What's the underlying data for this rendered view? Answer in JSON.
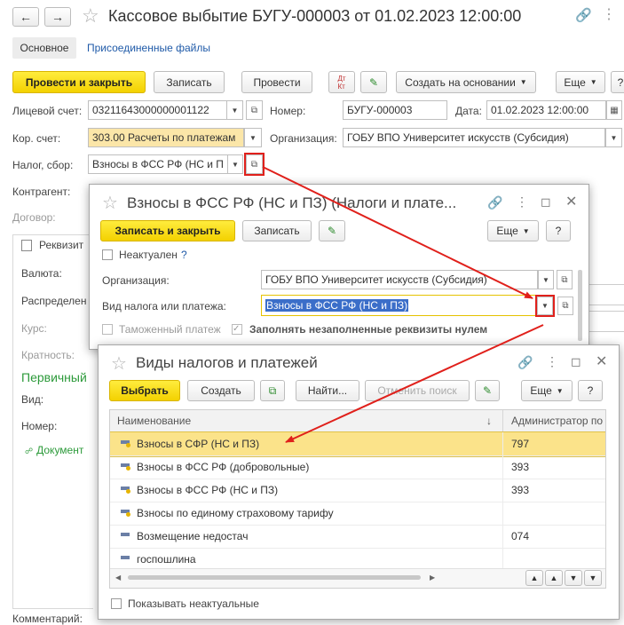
{
  "main": {
    "title": "Кассовое выбытие БУГУ-000003 от 01.02.2023 12:00:00",
    "tabs": [
      "Основное",
      "Присоединенные файлы"
    ],
    "toolbar": {
      "post_close": "Провести и закрыть",
      "save": "Записать",
      "post": "Провести",
      "create_based": "Создать на основании",
      "more": "Еще",
      "help": "?"
    },
    "fields": {
      "account_label": "Лицевой счет:",
      "account_value": "03211643000000001122",
      "corr_label": "Кор. счет:",
      "corr_value": "303.00 Расчеты по платежам",
      "tax_label": "Налог, сбор:",
      "tax_value": "Взносы в ФСС РФ (НС и П",
      "counterparty_label": "Контрагент:",
      "contract_label": "Договор:",
      "number_label": "Номер:",
      "number_value": "БУГУ-000003",
      "date_label": "Дата:",
      "date_value": "01.02.2023 12:00:00",
      "org_label": "Организация:",
      "org_value": "ГОБУ ВПО Университет искусств (Субсидия)"
    },
    "details": {
      "header": "Реквизит",
      "currency": "Валюта:",
      "distribution": "Распределен",
      "rate": "Курс:",
      "multiplicity": "Кратность:",
      "primary": "Первичный",
      "kind": "Вид:",
      "number": "Номер:",
      "document": "Документ"
    },
    "comment_label": "Комментарий:"
  },
  "tax_window": {
    "title": "Взносы в ФСС РФ (НС и ПЗ) (Налоги и плате...",
    "save_close": "Записать и закрыть",
    "save": "Записать",
    "more": "Еще",
    "help": "?",
    "inactive_label": "Неактуален",
    "inactive_help": "?",
    "org_label": "Организация:",
    "org_value": "ГОБУ ВПО Университет искусств (Субсидия)",
    "kind_label": "Вид налога или платежа:",
    "kind_value": "Взносы в ФСС РФ (НС и ПЗ)",
    "customs_label": "Таможенный платеж",
    "fill_zero_label": "Заполнять незаполненные реквизиты нулем"
  },
  "list_window": {
    "title": "Виды налогов и платежей",
    "select": "Выбрать",
    "create": "Создать",
    "find": "Найти...",
    "cancel_search": "Отменить поиск",
    "more": "Еще",
    "help": "?",
    "col_name": "Наименование",
    "col_admin": "Администратор по",
    "rows": [
      {
        "name": "Взносы в СФР (НС и ПЗ)",
        "admin": "797"
      },
      {
        "name": "Взносы в ФСС РФ (добровольные)",
        "admin": "393"
      },
      {
        "name": "Взносы в ФСС РФ (НС и ПЗ)",
        "admin": "393"
      },
      {
        "name": "Взносы по единому страховому тарифу",
        "admin": ""
      },
      {
        "name": "Возмещение недостач",
        "admin": "074"
      },
      {
        "name": "госпошлина",
        "admin": ""
      }
    ],
    "show_inactive": "Показывать неактуальные"
  },
  "colors": {
    "accent_yellow": "#f7d717",
    "highlight_red": "#e0201b",
    "link_blue": "#1f5aa8",
    "section_green": "#2c9a3a",
    "selected_row": "#fbe38a"
  }
}
